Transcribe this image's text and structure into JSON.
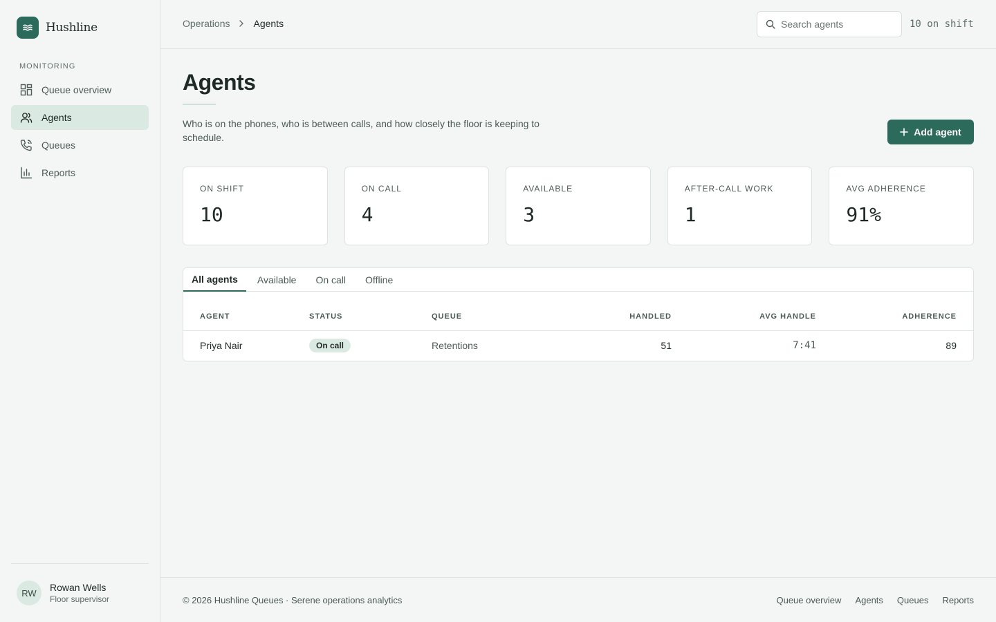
{
  "brand": {
    "name": "Hushline",
    "logo_icon": "waves-icon"
  },
  "sidebar": {
    "section_label": "MONITORING",
    "items": [
      {
        "label": "Queue overview",
        "icon": "dashboard-icon",
        "active": false
      },
      {
        "label": "Agents",
        "icon": "users-icon",
        "active": true
      },
      {
        "label": "Queues",
        "icon": "phone-icon",
        "active": false
      },
      {
        "label": "Reports",
        "icon": "bar-chart-icon",
        "active": false
      }
    ],
    "user": {
      "initials": "RW",
      "name": "Rowan Wells",
      "role": "Floor supervisor"
    }
  },
  "header": {
    "breadcrumb": [
      "Operations",
      "Agents"
    ],
    "search_placeholder": "Search agents",
    "shift_status": "10 on shift"
  },
  "page": {
    "title": "Agents",
    "description": "Who is on the phones, who is between calls, and how closely the floor is keeping to schedule.",
    "add_button": "Add agent"
  },
  "stats": [
    {
      "label": "ON SHIFT",
      "value": "10"
    },
    {
      "label": "ON CALL",
      "value": "4"
    },
    {
      "label": "AVAILABLE",
      "value": "3"
    },
    {
      "label": "AFTER-CALL WORK",
      "value": "1"
    },
    {
      "label": "AVG ADHERENCE",
      "value": "91%"
    }
  ],
  "tabs": [
    {
      "label": "All agents",
      "active": true
    },
    {
      "label": "Available",
      "active": false
    },
    {
      "label": "On call",
      "active": false
    },
    {
      "label": "Offline",
      "active": false
    }
  ],
  "table": {
    "columns": [
      "AGENT",
      "STATUS",
      "QUEUE",
      "HANDLED",
      "AVG HANDLE",
      "ADHERENCE"
    ],
    "rows": [
      {
        "agent": "Priya Nair",
        "status": "On call",
        "queue": "Retentions",
        "handled": "51",
        "avg_handle": "7:41",
        "adherence": "89"
      }
    ]
  },
  "footer": {
    "text": "© 2026 Hushline Queues · Serene operations analytics",
    "links": [
      "Queue overview",
      "Agents",
      "Queues",
      "Reports"
    ]
  },
  "colors": {
    "accent": "#2c6a5b",
    "accent_soft": "#dbe9e3",
    "background": "#f3f6f4"
  }
}
